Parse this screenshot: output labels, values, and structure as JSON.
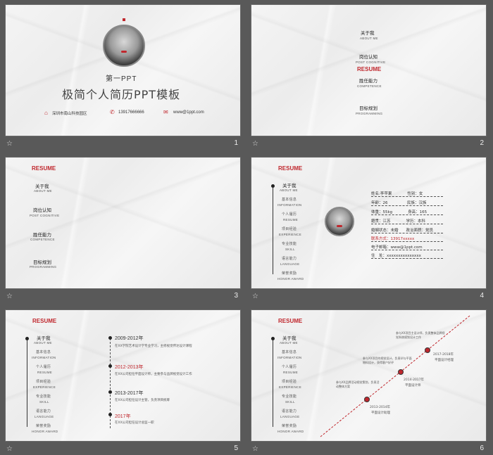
{
  "slide1": {
    "subtitle": "第一PPT",
    "title": "极简个人简历PPT模板",
    "address": "深圳市南山科技园区",
    "phone": "13917666666",
    "web": "www@1ppt.com",
    "number": "1"
  },
  "menu": {
    "about_cn": "关于我",
    "about_en": "ABOUT ME",
    "post_cn": "岗位认知",
    "post_en": "POST COGNITIVE",
    "resume": "RESUME",
    "comp_cn": "胜任能力",
    "comp_en": "COMPETENCE",
    "plan_cn": "目标规划",
    "plan_en": "PROGRAMMING"
  },
  "slide2": {
    "number": "2"
  },
  "slide3": {
    "number": "3"
  },
  "side": {
    "resume": "RESUME",
    "about_cn": "关于我",
    "about_en": "ABOUT ME",
    "info_cn": "基本信息",
    "info_en": "INFORMATION",
    "resume_cn": "个人履历",
    "resume_en": "RESUME",
    "exp_cn": "项目经验",
    "exp_en": "EXPERIENCE",
    "skill_cn": "专业技能",
    "skill_en": "SKILL",
    "lang_cn": "语言能力",
    "lang_en": "LANGUAGE",
    "honor_cn": "荣誉奖励",
    "honor_en": "HONOR AWARD"
  },
  "slide4": {
    "number": "4",
    "rows": [
      "姓名:李苹果　　　　性别：女",
      "年龄：26　　　　　民族：汉族",
      "体重：55kg　　　　身高：165",
      "籍贯：江苏　　　　学历：本科",
      "婚姻状态：未婚　　政治面貌：党员",
      "联系方式：13917xxxxx",
      "电子邮箱：www@1ppt.com",
      "住　址：xxxxxxxxxxxxxxx"
    ]
  },
  "slide5": {
    "number": "5",
    "entries": [
      {
        "year": "2009-2012年",
        "text": "在XX学院艺术设计学专业学习，主修视觉传达设计课程"
      },
      {
        "year": "2012-2013年",
        "text": "在XX公司担任平面设计师，主要参与品牌视觉设计工作"
      },
      {
        "year": "2013-2017年",
        "text": "在XX公司担任设计主管，负责项目统筹"
      },
      {
        "year": "2017年",
        "text": "在XX公司担任设计总监一职"
      }
    ]
  },
  "slide6": {
    "number": "6",
    "blocks": [
      {
        "text": "参与XX项目主设计师，负责整体品牌视觉系统规划设计工作"
      },
      {
        "text": "参与XX项目的视觉设计，负责UI与平面物料设计，获得客户好评"
      },
      {
        "text": "参与XX品牌活动视觉策划，负责活动整体方案"
      }
    ],
    "milestones": [
      {
        "year": "2013-2014年",
        "role": "平面设计助理"
      },
      {
        "year": "2014-2017年",
        "role": "平面设计师"
      },
      {
        "year": "2017-2018年",
        "role": "平面设计经理"
      }
    ]
  }
}
